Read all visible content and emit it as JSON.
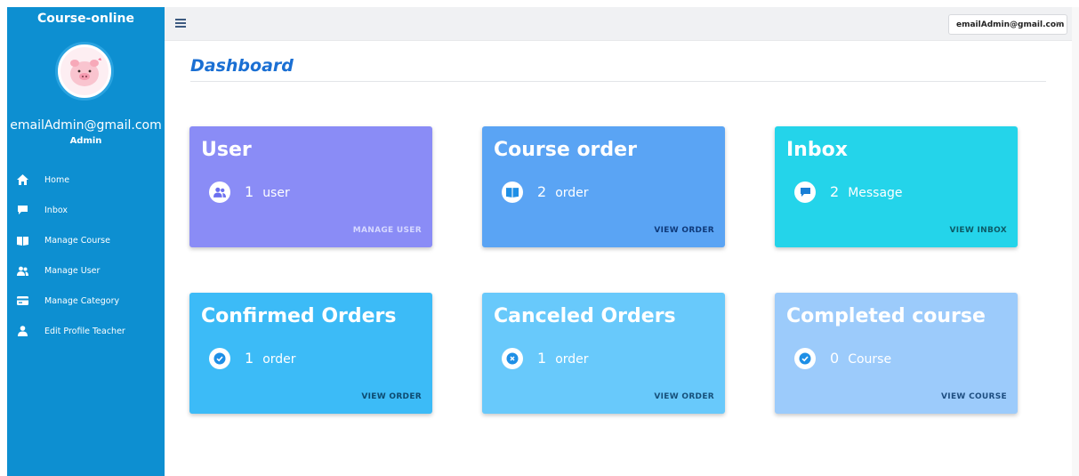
{
  "sidebar": {
    "brand": "Course-online",
    "email": "emailAdmin@gmail.com",
    "role": "Admin",
    "items": [
      {
        "label": "Home",
        "icon": "home-icon"
      },
      {
        "label": "Inbox",
        "icon": "chat-icon"
      },
      {
        "label": "Manage Course",
        "icon": "book-icon"
      },
      {
        "label": "Manage User",
        "icon": "users-icon"
      },
      {
        "label": "Manage Category",
        "icon": "card-icon"
      },
      {
        "label": "Edit Profile Teacher",
        "icon": "user-icon"
      }
    ]
  },
  "topbar": {
    "account": "emailAdmin@gmail.com"
  },
  "page": {
    "title": "Dashboard"
  },
  "cards": [
    {
      "title": "User",
      "count": "1",
      "unit": "user",
      "link": "MANAGE USER",
      "color": "#8a8cf6",
      "link_color": "#d6d8ff",
      "icon": "users-icon"
    },
    {
      "title": "Course order",
      "count": "2",
      "unit": "order",
      "link": "VIEW ORDER",
      "color": "#5aa4f4",
      "link_color": "#0f3a7a",
      "icon": "book-icon"
    },
    {
      "title": "Inbox",
      "count": "2",
      "unit": "Message",
      "link": "VIEW INBOX",
      "color": "#24d4ea",
      "link_color": "#0c5a66",
      "icon": "chat-icon"
    },
    {
      "title": "Confirmed Orders",
      "count": "1",
      "unit": "order",
      "link": "VIEW ORDER",
      "color": "#3cbbf7",
      "link_color": "#0d4a70",
      "icon": "check-icon"
    },
    {
      "title": "Canceled Orders",
      "count": "1",
      "unit": "order",
      "link": "VIEW ORDER",
      "color": "#68c9fb",
      "link_color": "#16507a",
      "icon": "x-circle-icon"
    },
    {
      "title": "Completed course",
      "count": "0",
      "unit": "Course",
      "link": "VIEW COURSE",
      "color": "#9ccbfb",
      "link_color": "#1e4e80",
      "icon": "check-icon"
    }
  ]
}
